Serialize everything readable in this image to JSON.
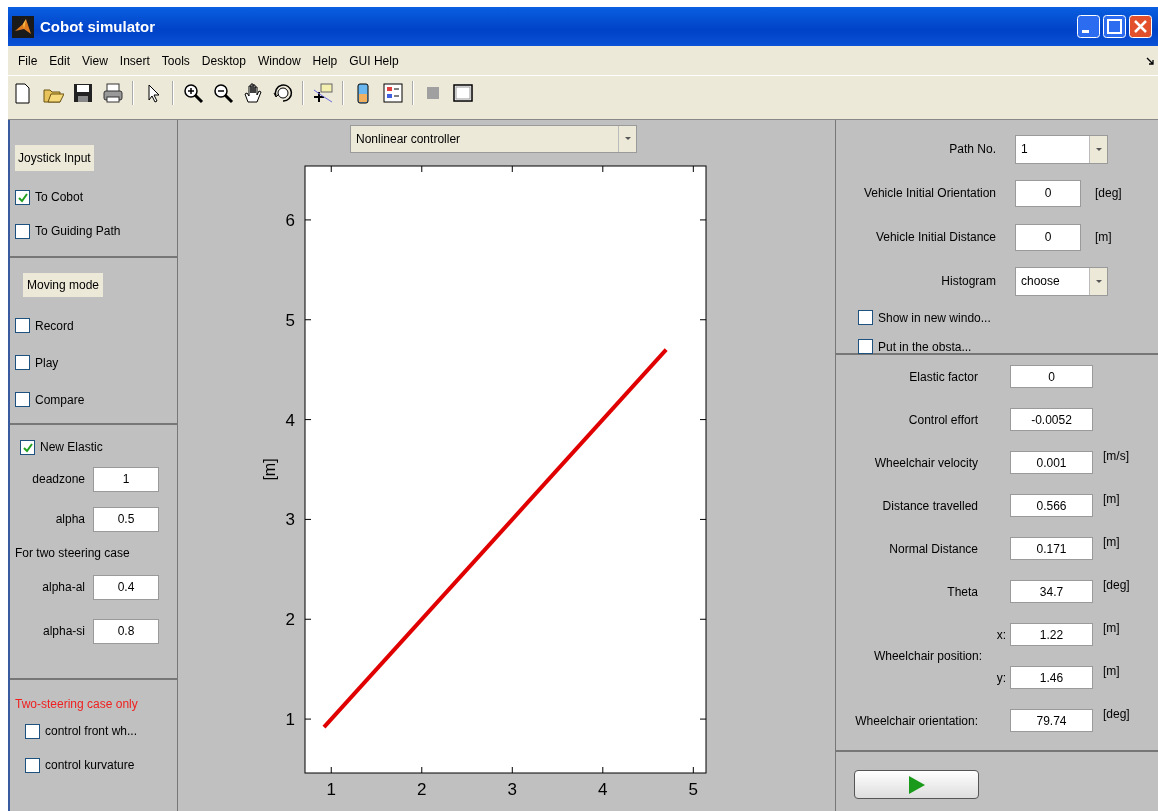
{
  "window": {
    "title": "Cobot simulator"
  },
  "menu": [
    "File",
    "Edit",
    "View",
    "Insert",
    "Tools",
    "Desktop",
    "Window",
    "Help",
    "GUI Help"
  ],
  "left_panel": {
    "joystick": {
      "title": "Joystick Input",
      "options": [
        {
          "label": "To Cobot",
          "checked": true
        },
        {
          "label": "To Guiding Path",
          "checked": false
        }
      ]
    },
    "moving_mode": {
      "title": "Moving mode",
      "options": [
        {
          "label": "Record",
          "checked": false
        },
        {
          "label": "Play",
          "checked": false
        },
        {
          "label": "Compare",
          "checked": false
        }
      ]
    },
    "elastic": {
      "option": {
        "label": "New Elastic",
        "checked": true
      },
      "fields": [
        {
          "label": "deadzone",
          "value": "1"
        },
        {
          "label": "alpha",
          "value": "0.5"
        }
      ],
      "note": "For two steering case",
      "two_steering_fields": [
        {
          "label": "alpha-al",
          "value": "0.4"
        },
        {
          "label": "alpha-si",
          "value": "0.8"
        }
      ]
    },
    "two_steering": {
      "title": "Two-steering case only",
      "options": [
        {
          "label": "control front wh...",
          "checked": false
        },
        {
          "label": "control kurvature",
          "checked": false
        }
      ]
    }
  },
  "plot_panel": {
    "controller": {
      "value": "Nonlinear controller"
    },
    "chart_data": {
      "type": "line",
      "ylabel": "[m]",
      "x": [
        0.92,
        4.7
      ],
      "series": [
        {
          "color": "#e00000",
          "values": [
            0.92,
            4.7
          ]
        }
      ],
      "xlim": [
        0.71,
        5.14
      ],
      "ylim": [
        0.46,
        6.54
      ],
      "xticks": [
        1,
        2,
        3,
        4,
        5
      ],
      "yticks": [
        1,
        2,
        3,
        4,
        5,
        6
      ]
    }
  },
  "right_panel": {
    "settings": [
      {
        "kind": "dropdown",
        "label": "Path No.",
        "value": "1"
      },
      {
        "kind": "field",
        "label": "Vehicle Initial Orientation",
        "value": "0",
        "unit": "[deg]"
      },
      {
        "kind": "field",
        "label": "Vehicle Initial Distance",
        "value": "0",
        "unit": "[m]"
      },
      {
        "kind": "dropdown",
        "label": "Histogram",
        "value": "choose"
      }
    ],
    "options": [
      {
        "label": "Show in new windo...",
        "checked": false
      },
      {
        "label": "Put in the obsta...",
        "checked": false
      }
    ],
    "readouts": [
      {
        "kind": "field",
        "label": "Elastic factor",
        "value": "0"
      },
      {
        "kind": "field",
        "label": "Control effort",
        "value": "-0.0052"
      },
      {
        "kind": "field",
        "label": "Wheelchair velocity",
        "value": "0.001",
        "unit": "[m/s]"
      },
      {
        "kind": "field",
        "label": "Distance travelled",
        "value": "0.566",
        "unit": "[m]"
      },
      {
        "kind": "field",
        "label": "Normal Distance",
        "value": "0.171",
        "unit": "[m]"
      },
      {
        "kind": "field",
        "label": "Theta",
        "value": "34.7",
        "unit": "[deg]"
      },
      {
        "kind": "pair",
        "label": "Wheelchair position:",
        "x": {
          "label": "x:",
          "value": "1.22",
          "unit": "[m]"
        },
        "y": {
          "label": "y:",
          "value": "1.46",
          "unit": "[m]"
        }
      },
      {
        "kind": "field",
        "label": "Wheelchair orientation:",
        "value": "79.74",
        "unit": "[deg]"
      }
    ]
  }
}
